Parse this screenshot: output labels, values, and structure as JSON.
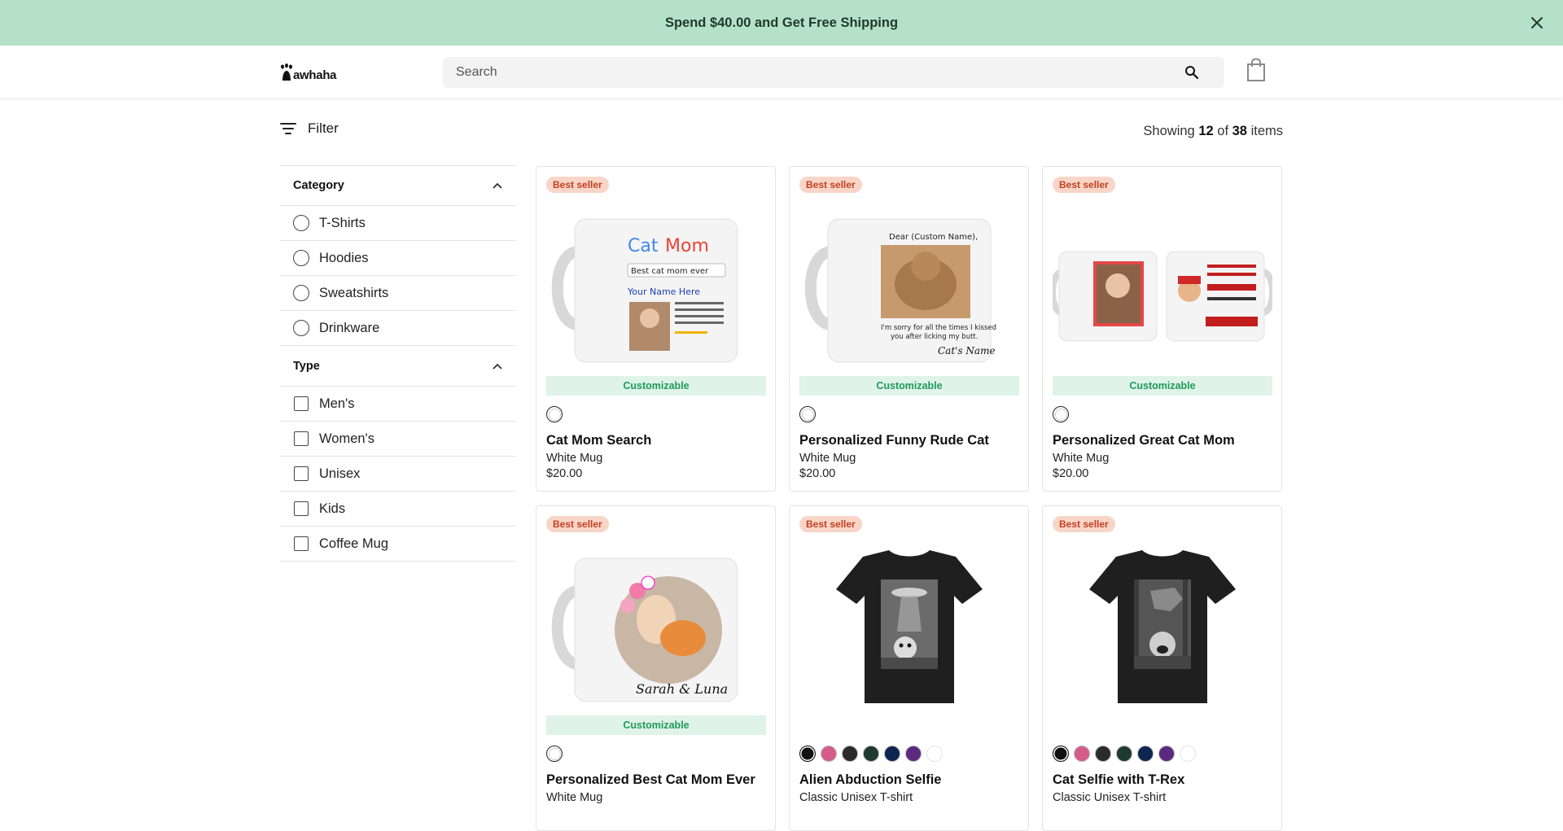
{
  "announcement": {
    "text": "Spend $40.00 and Get Free Shipping",
    "close_icon": "close-icon"
  },
  "header": {
    "logo_text": "awhaha",
    "search_placeholder": "Search",
    "search_icon": "search-icon",
    "cart_icon": "shopping-bag-icon"
  },
  "toolbar": {
    "filter_label": "Filter",
    "showing_prefix": "Showing",
    "shown_count": "12",
    "of_word": "of",
    "total_count": "38",
    "items_word": "items"
  },
  "sidebar": {
    "category": {
      "title": "Category",
      "options": [
        "T-Shirts",
        "Hoodies",
        "Sweatshirts",
        "Drinkware"
      ]
    },
    "type": {
      "title": "Type",
      "options": [
        "Men's",
        "Women's",
        "Unisex",
        "Kids",
        "Coffee Mug"
      ]
    }
  },
  "colors": {
    "announcement_bg": "#b5e1c9",
    "badge_bg": "#f9d5c8",
    "badge_text": "#c2411f",
    "customizable_bg": "#dff3e8",
    "customizable_text": "#1f9a5a"
  },
  "products": [
    {
      "badge": "Best seller",
      "tag": "Customizable",
      "name": "Cat Mom Search",
      "type": "White Mug",
      "price": "$20.00",
      "image": "mug-cat-mom-search",
      "swatches": [
        "#ffffff"
      ]
    },
    {
      "badge": "Best seller",
      "tag": "Customizable",
      "name": "Personalized Funny Rude Cat",
      "type": "White Mug",
      "price": "$20.00",
      "image": "mug-rude-cat",
      "swatches": [
        "#ffffff"
      ]
    },
    {
      "badge": "Best seller",
      "tag": "Customizable",
      "name": "Personalized Great Cat Mom",
      "type": "White Mug",
      "price": "$20.00",
      "image": "mug-great-cat-mom",
      "swatches": [
        "#ffffff"
      ]
    },
    {
      "badge": "Best seller",
      "tag": "Customizable",
      "name": "Personalized Best Cat Mom Ever",
      "type": "White Mug",
      "price": "",
      "image": "mug-best-cat-mom",
      "swatches": [
        "#ffffff"
      ]
    },
    {
      "badge": "Best seller",
      "tag": "",
      "name": "Alien Abduction Selfie",
      "type": "Classic Unisex T-shirt",
      "price": "",
      "image": "tshirt-alien-selfie",
      "swatches": [
        "#111111",
        "#d45c8a",
        "#2b2b2b",
        "#1f3a30",
        "#0e2550",
        "#5b2a7e",
        "#ffffff"
      ]
    },
    {
      "badge": "Best seller",
      "tag": "",
      "name": "Cat Selfie with T-Rex",
      "type": "Classic Unisex T-shirt",
      "price": "",
      "image": "tshirt-trex-selfie",
      "swatches": [
        "#111111",
        "#d45c8a",
        "#2b2b2b",
        "#1f3a30",
        "#0e2550",
        "#5b2a7e",
        "#ffffff"
      ]
    }
  ]
}
